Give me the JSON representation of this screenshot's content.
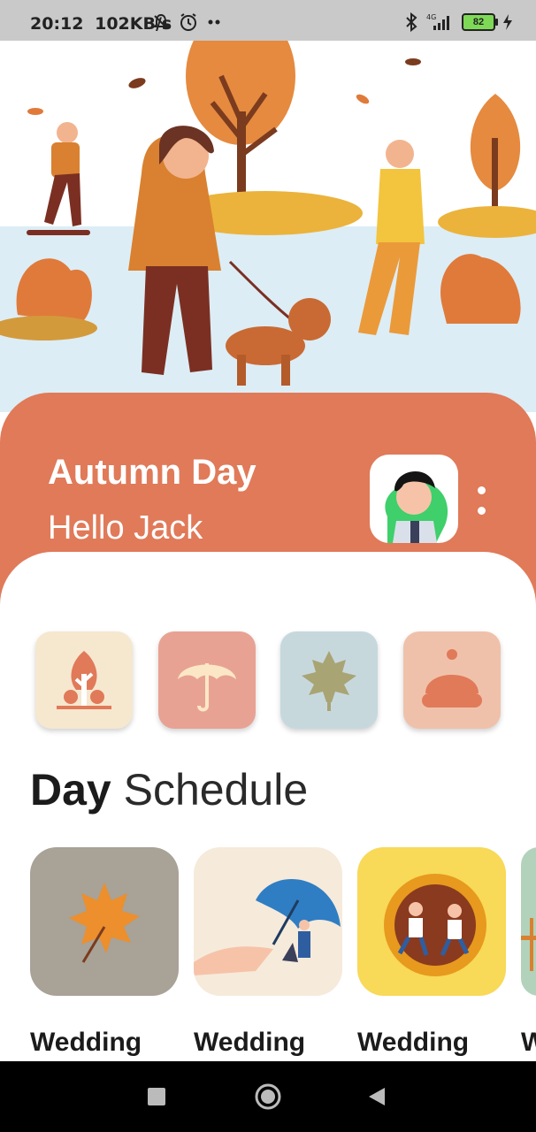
{
  "status_bar": {
    "time": "20:12",
    "speed": "102KB/s",
    "battery": "82",
    "icons": [
      "bell-off-icon",
      "alarm-icon",
      "bluetooth-icon",
      "signal-icon",
      "charging-icon"
    ]
  },
  "header": {
    "title": "Autumn Day",
    "subtitle": "Hello Jack",
    "color": "#e07a59"
  },
  "categories": [
    {
      "icon": "tree-icon",
      "bg": "#f6e7cf"
    },
    {
      "icon": "umbrella-icon",
      "bg": "#e8a293"
    },
    {
      "icon": "maple-leaf-icon",
      "bg": "#c7d8dd"
    },
    {
      "icon": "hat-icon",
      "bg": "#f0c1aa"
    }
  ],
  "schedule": {
    "title_bold": "Day",
    "title_light": "Schedule",
    "cards": [
      {
        "label": "Wedding",
        "bg": "#a8a297"
      },
      {
        "label": "Wedding",
        "bg": "#f6eadb"
      },
      {
        "label": "Wedding",
        "bg": "#f8d958"
      },
      {
        "label": "W",
        "bg": "#b3d2bb"
      }
    ]
  }
}
